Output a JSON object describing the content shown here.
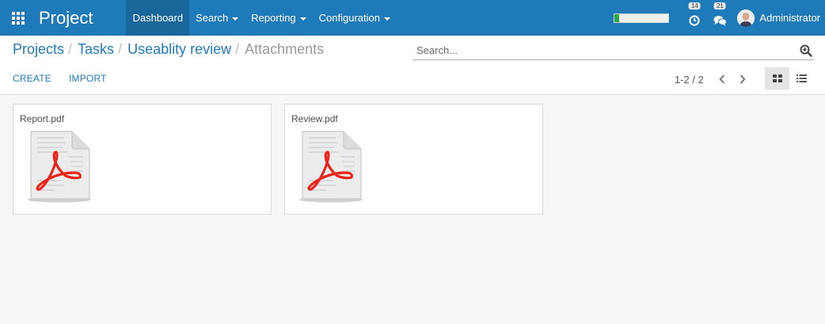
{
  "app": {
    "title": "Project"
  },
  "menu": {
    "items": [
      {
        "label": "Dashboard",
        "active": true,
        "dropdown": false
      },
      {
        "label": "Search",
        "active": false,
        "dropdown": true
      },
      {
        "label": "Reporting",
        "active": false,
        "dropdown": true
      },
      {
        "label": "Configuration",
        "active": false,
        "dropdown": true
      }
    ]
  },
  "systray": {
    "progress_fraction": 0.08,
    "activities_count": "14",
    "messages_count": "21",
    "user_name": "Administrator"
  },
  "breadcrumb": {
    "items": [
      "Projects",
      "Tasks",
      "Useablity review"
    ],
    "separator": "/",
    "current": "Attachments"
  },
  "search": {
    "placeholder": "Search..."
  },
  "buttons": {
    "create": "CREATE",
    "import": "IMPORT"
  },
  "pager": {
    "value": "1-2 / 2"
  },
  "attachments": [
    {
      "name": "Report.pdf",
      "icon": "pdf-file-icon"
    },
    {
      "name": "Review.pdf",
      "icon": "pdf-file-icon"
    }
  ],
  "colors": {
    "brand": "#1f7ab9",
    "active_menu": "#19669b",
    "pdf_red": "#e8251b",
    "progress": "#28a745"
  }
}
